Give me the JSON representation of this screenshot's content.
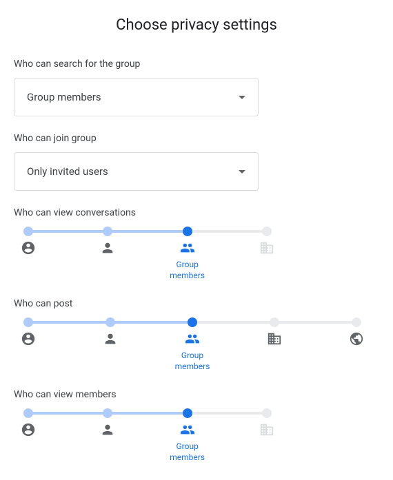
{
  "title": "Choose privacy settings",
  "dropdowns": [
    {
      "label": "Who can search for the group",
      "value": "Group members"
    },
    {
      "label": "Who can join group",
      "value": "Only invited users"
    }
  ],
  "sliders": [
    {
      "label": "Who can view conversations",
      "selectedIndex": 2,
      "stops": [
        {
          "icon": "account-circle",
          "enabled": true
        },
        {
          "icon": "person",
          "enabled": true
        },
        {
          "icon": "group",
          "enabled": true,
          "caption": "Group\nmembers"
        },
        {
          "icon": "domain",
          "enabled": false
        }
      ]
    },
    {
      "label": "Who can post",
      "selectedIndex": 2,
      "stops": [
        {
          "icon": "account-circle",
          "enabled": true
        },
        {
          "icon": "person",
          "enabled": true
        },
        {
          "icon": "group",
          "enabled": true,
          "caption": "Group\nmembers"
        },
        {
          "icon": "domain",
          "enabled": true
        },
        {
          "icon": "public",
          "enabled": true
        }
      ]
    },
    {
      "label": "Who can view members",
      "selectedIndex": 2,
      "stops": [
        {
          "icon": "account-circle",
          "enabled": true
        },
        {
          "icon": "person",
          "enabled": true
        },
        {
          "icon": "group",
          "enabled": true,
          "caption": "Group\nmembers"
        },
        {
          "icon": "domain",
          "enabled": false
        }
      ]
    }
  ],
  "colors": {
    "primary": "#1a73e8",
    "track": "#aecbfa"
  }
}
